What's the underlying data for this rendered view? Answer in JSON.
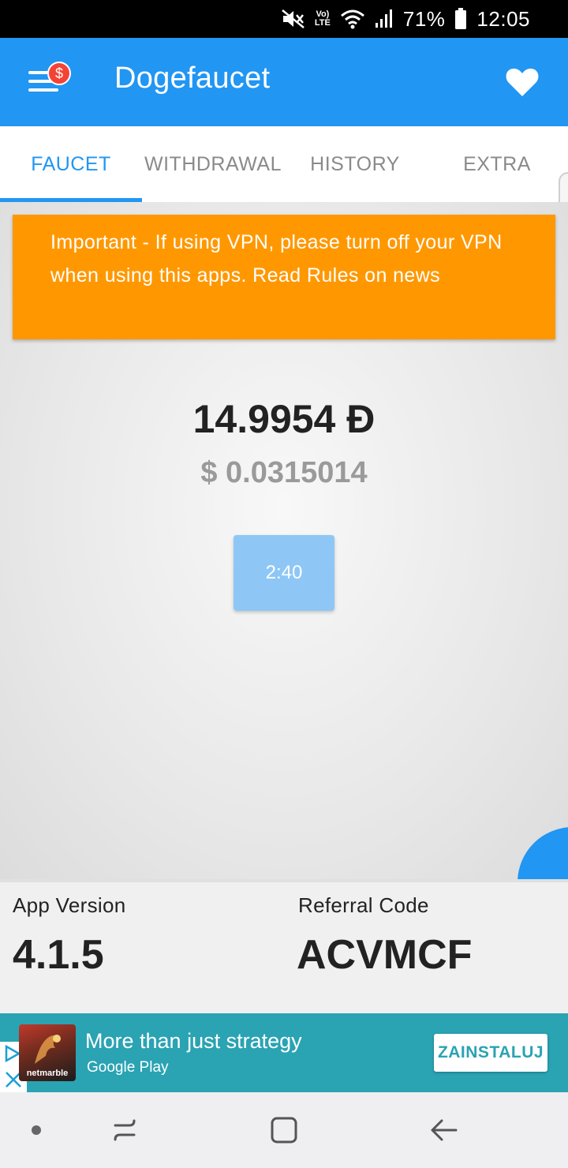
{
  "status_bar": {
    "battery_text": "71%",
    "time": "12:05",
    "lte_top": "Vo)",
    "lte_bottom": "LTE",
    "icons": [
      "mute-icon",
      "volte-icon",
      "wifi-icon",
      "signal-icon",
      "battery-icon"
    ]
  },
  "app_bar": {
    "title": "Dogefaucet",
    "badge_symbol": "$",
    "menu_icon": "hamburger-menu-icon",
    "favorite_icon": "heart-icon"
  },
  "tabs": [
    {
      "label": "FAUCET",
      "active": true
    },
    {
      "label": "WITHDRAWAL",
      "active": false
    },
    {
      "label": "HISTORY",
      "active": false
    },
    {
      "label": "EXTRA",
      "active": false
    }
  ],
  "notice": {
    "text": "Important - If using VPN, please turn off your VPN when using this apps. Read Rules on news"
  },
  "balance": {
    "doge": "14.9954 Đ",
    "usd": "$ 0.0315014"
  },
  "claim_button": {
    "label": "2:40"
  },
  "info": {
    "app_version_label": "App Version",
    "app_version_value": "4.1.5",
    "referral_label": "Referral Code",
    "referral_value": "ACVMCF"
  },
  "ad": {
    "title": "More than just strategy",
    "subtitle": "Google Play",
    "install_label": "ZAINSTALUJ",
    "logo_text": "netmarble"
  },
  "colors": {
    "primary": "#2196f3",
    "notice": "#ff9800",
    "ad_background": "#2aa3b3",
    "badge": "#f44336"
  },
  "nav_bar": {
    "icons": [
      "dot-icon",
      "recent-apps-icon",
      "home-icon",
      "back-icon"
    ]
  }
}
